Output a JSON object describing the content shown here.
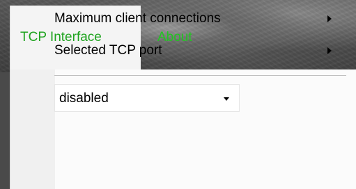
{
  "menubar": {
    "items": [
      {
        "label": "TCP Interface",
        "active": true
      },
      {
        "label": "About",
        "active": false
      }
    ]
  },
  "dropdown": {
    "items": [
      {
        "label": "Maximum client connections",
        "has_submenu": true,
        "icon": "chevron-right-icon"
      },
      {
        "label": "Selected TCP port",
        "has_submenu": true,
        "icon": "chevron-right-icon"
      }
    ],
    "select": {
      "value": "disabled",
      "icon": "chevron-down-icon"
    }
  },
  "colors": {
    "menu_text": "#1ea31e",
    "menu_bg": "#f4f4f4",
    "dropdown_bg": "#fbfbfb",
    "separator": "#bdbdbd"
  }
}
